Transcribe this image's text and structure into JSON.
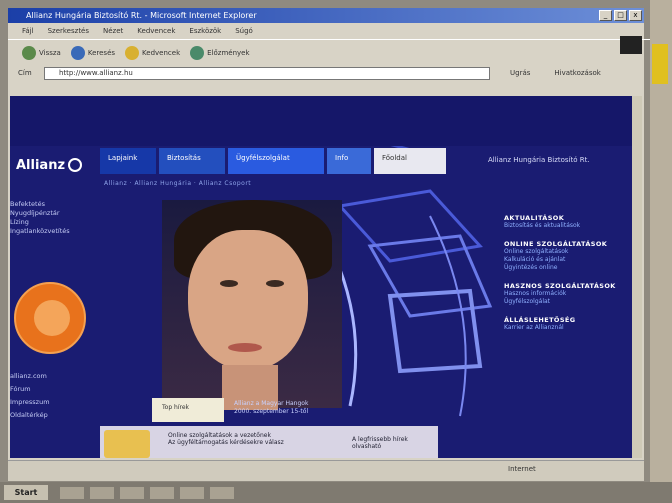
{
  "window": {
    "title": "Allianz Hungária Biztosító Rt. - Microsoft Internet Explorer",
    "controls": [
      "_",
      "□",
      "x"
    ]
  },
  "menu": [
    "Fájl",
    "Szerkesztés",
    "Nézet",
    "Kedvencek",
    "Eszközök",
    "Súgó"
  ],
  "toolbar": {
    "back": "Vissza",
    "search": "Keresés",
    "favorites": "Kedvencek",
    "history": "Előzmények"
  },
  "address": {
    "label": "Cím",
    "url": "http://www.allianz.hu",
    "go": "Ugrás",
    "links": "Hivatkozások"
  },
  "site": {
    "logo": "Allianz",
    "company": "Allianz Hungária Biztosító Rt.",
    "nav": [
      "Lapjaink",
      "Biztosítás",
      "Ügyfélszolgálat",
      "Info",
      "Főoldal"
    ],
    "subnav": "Allianz · Allianz Hungária · Allianz Csoport",
    "left_top": [
      "Befektetés",
      "Nyugdíjpénztár",
      "Lízing",
      "Ingatlanközvetítés"
    ],
    "left_bottom": [
      "allianz.com",
      "Fórum",
      "Impresszum",
      "Oldaltérkép"
    ],
    "right": [
      {
        "heading": "AKTUALITÁSOK",
        "items": [
          "Biztosítás és aktualitások"
        ]
      },
      {
        "heading": "ONLINE SZOLGÁLTATÁSOK",
        "items": [
          "Online szolgáltatások",
          "Kalkuláció és ajánlat",
          "Ügyintézés online"
        ]
      },
      {
        "heading": "HASZNOS SZOLGÁLTATÁSOK",
        "items": [
          "Hasznos információk",
          "Ügyfélszolgálat"
        ]
      },
      {
        "heading": "ÁLLÁSLEHETŐSÉG",
        "items": [
          "Karrier az Allianznál"
        ]
      }
    ],
    "top_news_label": "Top hírek",
    "top_news_text": [
      "Allianz a Magyar Hangok",
      "2000. szeptember 15-től"
    ],
    "promo_left": [
      "Online szolgáltatások a vezetőnek",
      "Az ügyféltámogatás kérdésekre válasz"
    ],
    "promo_right": [
      "A legfrissebb hírek",
      "olvasható"
    ]
  },
  "status": {
    "zone": "Internet"
  },
  "taskbar": {
    "start": "Start"
  }
}
